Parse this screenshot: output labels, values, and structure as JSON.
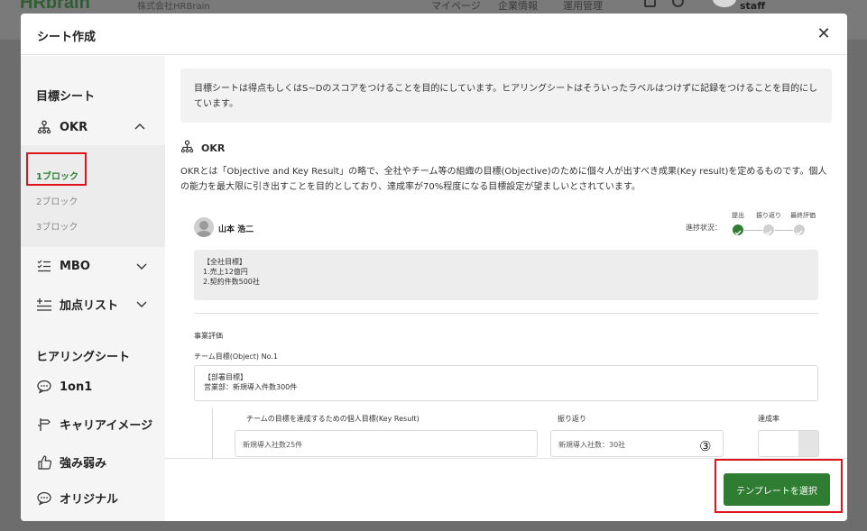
{
  "background": {
    "logo": "HRbrain",
    "logo_sub": "株式会社HRBrain",
    "nav": [
      "マイページ",
      "企業情報",
      "運用管理"
    ],
    "user": "staff"
  },
  "modal": {
    "title": "シート作成",
    "close_icon": "close-icon"
  },
  "sidebar": {
    "goal_heading": "目標シート",
    "items": [
      {
        "label": "OKR",
        "icon": "org-chart-icon",
        "chevron": "chevron-up-icon"
      },
      {
        "label": "MBO",
        "icon": "checklist-icon",
        "chevron": "chevron-down-icon"
      },
      {
        "label": "加点リスト",
        "icon": "list-plus-icon",
        "chevron": "chevron-down-icon"
      }
    ],
    "sub_items": [
      "1ブロック",
      "2ブロック",
      "3ブロック"
    ],
    "hearing_heading": "ヒアリングシート",
    "hearing_items": [
      {
        "label": "1on1",
        "icon": "chat-icon"
      },
      {
        "label": "キャリアイメージ",
        "icon": "signpost-icon"
      },
      {
        "label": "強み弱み",
        "icon": "thumbs-up-icon"
      },
      {
        "label": "オリジナル",
        "icon": "chat-bubble-icon"
      }
    ]
  },
  "content": {
    "notice": "目標シートは得点もしくはS~Dのスコアをつけることを目的にしています。ヒアリングシートはそういったラベルはつけずに記録をつけることを目的にしています。",
    "okr_title": "OKR",
    "okr_desc": "OKRとは「Objective and Key Result」の略で、全社やチーム等の組織の目標(Objective)のために個々人が出すべき成果(Key result)を定めるものです。個人の能力を最大限に引き出すことを目的としており、達成率が70%程度になる目標設定が望ましいとされています。",
    "preview": {
      "user_name": "山本 浩二",
      "progress_label": "進捗状況：",
      "steps": [
        "提出",
        "振り返り",
        "最終評価"
      ],
      "company_goal_title": "【全社目標】",
      "company_goal_lines": [
        "1.売上12億円",
        "2.契約件数500社"
      ],
      "section_label": "事業評価",
      "team_objective_label": "チーム目標(Object) No.1",
      "dept_goal_title": "【部署目標】",
      "dept_goal_line": "営業部：新規導入件数300件",
      "col_kr": "チームの目標を達成するための個人目標(Key Result)",
      "col_reflection": "振り返り",
      "col_rate": "達成率",
      "kr_value": "新規導入社数25件",
      "reflection_value": "新規導入社数：30社"
    }
  },
  "footer": {
    "select_button": "テンプレートを選択",
    "marker": "③"
  },
  "colors": {
    "accent": "#2e7d32",
    "highlight": "#e0141c"
  }
}
